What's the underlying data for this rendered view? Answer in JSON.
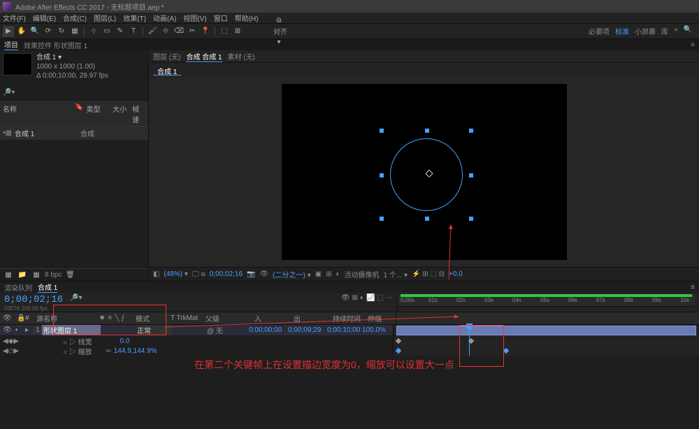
{
  "window": {
    "title": "Adobe After Effects CC 2017 - 无标题项目.aep *"
  },
  "menu": [
    "文件(F)",
    "编辑(E)",
    "合成(C)",
    "图层(L)",
    "效果(T)",
    "动画(A)",
    "视图(V)",
    "窗口",
    "帮助(H)"
  ],
  "toolbar_right": {
    "a": "必要项",
    "b": "标准",
    "c": "小屏幕",
    "d": "库"
  },
  "snap_label": "对齐",
  "bar2": "效果控件 形状图层 1",
  "panel": {
    "tabs": [
      "项目"
    ],
    "comp_name": "合成 1 ▾",
    "dims": "1000 x 1000 (1.00)",
    "fps": "Δ 0;00;10;00, 29.97 fps",
    "cols": {
      "name": "名称",
      "type": "类型",
      "size": "大小",
      "fr": "帧速"
    },
    "row": {
      "name": "合成 1",
      "type": "合成"
    }
  },
  "comp_tabs": {
    "a": "图层 (无)",
    "b": "合成 合成 1",
    "c": "素材 (无)",
    "sub": "合成 1"
  },
  "viewer_bar": {
    "zoom": "(48%)",
    "tc": "0;00;02;16",
    "ratio": "(二分之一)",
    "cam": "活动摄像机",
    "views": "1 个...",
    "exposure": "+0.0"
  },
  "btabs": [
    "渲染队列",
    "合成 1"
  ],
  "timecode": {
    "main": "0;00;02;16",
    "sub": "00076 100.00 fps"
  },
  "tl_cols": {
    "src": "源名称",
    "mode_h": "模式",
    "mode_v": "正常",
    "trk": "T TrkMat",
    "parent": "父级",
    "none": "无",
    "in": "入",
    "out": "出",
    "dur": "持续时间",
    "stretch": "伸缩",
    "in_v": "0;00;00;00",
    "out_v": "0;00;09;29",
    "dur_v": "0;00;10;00",
    "str_v": "100.0%"
  },
  "layer": {
    "num": "1",
    "name": "形状图层 1"
  },
  "props": {
    "p1": "○ ▷ 线宽",
    "p1v": "0.0",
    "p2": "○ ▷ 缩放",
    "p2v": "144.9,144.9%",
    "link": "∞"
  },
  "ticks": [
    "0;00s",
    "01s",
    "02s",
    "03s",
    "04s",
    "05s",
    "06s",
    "07s",
    "08s",
    "09s",
    "10s"
  ],
  "annotation": "在第二个关键帧上在设置描边宽度为0，缩放可以设置大一点",
  "footer_bpc": "8 bpc"
}
